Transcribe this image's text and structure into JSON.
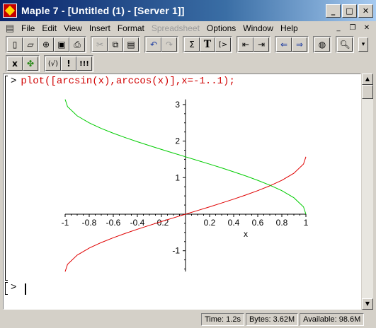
{
  "window": {
    "title": "Maple 7  - [Untitled (1) - [Server 1]]"
  },
  "menu": {
    "items": [
      {
        "label": "File",
        "disabled": false
      },
      {
        "label": "Edit",
        "disabled": false
      },
      {
        "label": "View",
        "disabled": false
      },
      {
        "label": "Insert",
        "disabled": false
      },
      {
        "label": "Format",
        "disabled": false
      },
      {
        "label": "Spreadsheet",
        "disabled": true
      },
      {
        "label": "Options",
        "disabled": false
      },
      {
        "label": "Window",
        "disabled": false
      },
      {
        "label": "Help",
        "disabled": false
      }
    ]
  },
  "toolbar": {
    "sigma": "Σ",
    "text_t": "T",
    "exec_prompt": "[>",
    "row2_x": "x",
    "row2_check": "(√)",
    "row2_bang": "!",
    "row2_bangs": "!!!"
  },
  "worksheet": {
    "prompt": ">",
    "command": "plot([arcsin(x),arccos(x)],x=-1..1);",
    "empty_prompt": ">"
  },
  "chart_data": {
    "type": "line",
    "title": "",
    "xlabel": "x",
    "ylabel": "",
    "xlim": [
      -1,
      1
    ],
    "ylim": [
      -1.57,
      3.14
    ],
    "x_ticks": [
      "-1",
      "-0.8",
      "-0.6",
      "-0.4",
      "-0.2",
      "0.2",
      "0.4",
      "0.6",
      "0.8",
      "1"
    ],
    "y_ticks": [
      "3",
      "2",
      "1",
      "-1"
    ],
    "series": [
      {
        "color": "#e00000",
        "x": [
          -1,
          -0.98,
          -0.9,
          -0.8,
          -0.7,
          -0.6,
          -0.5,
          -0.4,
          -0.3,
          -0.2,
          -0.1,
          0,
          0.1,
          0.2,
          0.3,
          0.4,
          0.5,
          0.6,
          0.7,
          0.8,
          0.9,
          0.98,
          1
        ],
        "values": [
          -1.5708,
          -1.3705,
          -1.1198,
          -0.9273,
          -0.7754,
          -0.6435,
          -0.5236,
          -0.4115,
          -0.3047,
          -0.2014,
          -0.1002,
          0,
          0.1002,
          0.2014,
          0.3047,
          0.4115,
          0.5236,
          0.6435,
          0.7754,
          0.9273,
          1.1198,
          1.3705,
          1.5708
        ]
      },
      {
        "color": "#00cc00",
        "x": [
          -1,
          -0.98,
          -0.9,
          -0.8,
          -0.7,
          -0.6,
          -0.5,
          -0.4,
          -0.3,
          -0.2,
          -0.1,
          0,
          0.1,
          0.2,
          0.3,
          0.4,
          0.5,
          0.6,
          0.7,
          0.8,
          0.9,
          0.98,
          1
        ],
        "values": [
          3.1416,
          2.9413,
          2.6906,
          2.4981,
          2.3462,
          2.2143,
          2.0944,
          1.9823,
          1.8755,
          1.7722,
          1.671,
          1.5708,
          1.4706,
          1.3694,
          1.2661,
          1.1593,
          1.0472,
          0.9273,
          0.7954,
          0.6435,
          0.451,
          0.2003,
          0
        ]
      }
    ]
  },
  "status": {
    "time": "Time:  1.2s",
    "bytes": "Bytes: 3.62M",
    "available": "Available: 98.6M"
  }
}
